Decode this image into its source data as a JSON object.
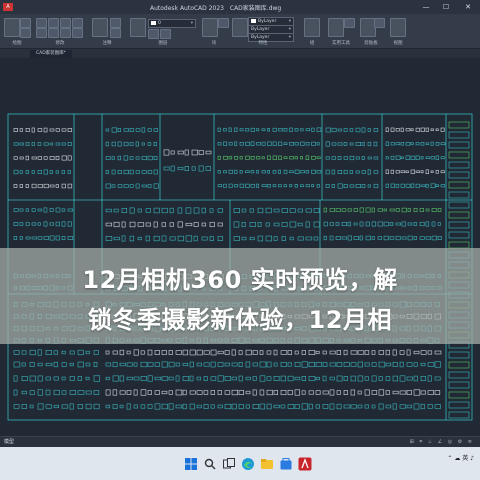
{
  "window": {
    "app_icon": "A",
    "title_parts": [
      "Autodesk AutoCAD 2023",
      "CAD家装图库.dwg"
    ],
    "controls": [
      "—",
      "☐",
      "✕"
    ]
  },
  "ribbon": {
    "group_labels": [
      "绘图",
      "修改",
      "注释",
      "图层",
      "块",
      "特性",
      "组",
      "实用工具",
      "剪贴板",
      "视图"
    ],
    "layer_value": "0",
    "property_value": "ByLayer",
    "linetype_value": "ByLayer",
    "lineweight_value": "ByLayer"
  },
  "tabs": [
    "CAD家装图库*"
  ],
  "overlay": {
    "line1": "12月相机360 实时预览，解",
    "line2": "锁冬季摄影新体验，12月相"
  },
  "statusbar": {
    "model_label": "模型",
    "icons": "⊞ ⌗ ⊥ ∠ ◎ ⚙ ≡"
  },
  "taskbar": {
    "apps": [
      "start-icon",
      "search-icon",
      "task-view-icon",
      "edge-icon",
      "explorer-icon",
      "store-icon",
      "autocad-icon"
    ],
    "tray_icons": "⌃ ☁ 英 ♪"
  },
  "colors": {
    "canvas": "#212934",
    "drawing_lines": "#3ab8c0",
    "accent_green": "#58c86b",
    "white_lines": "#d8dde2",
    "banner": "#a8b2ac"
  }
}
